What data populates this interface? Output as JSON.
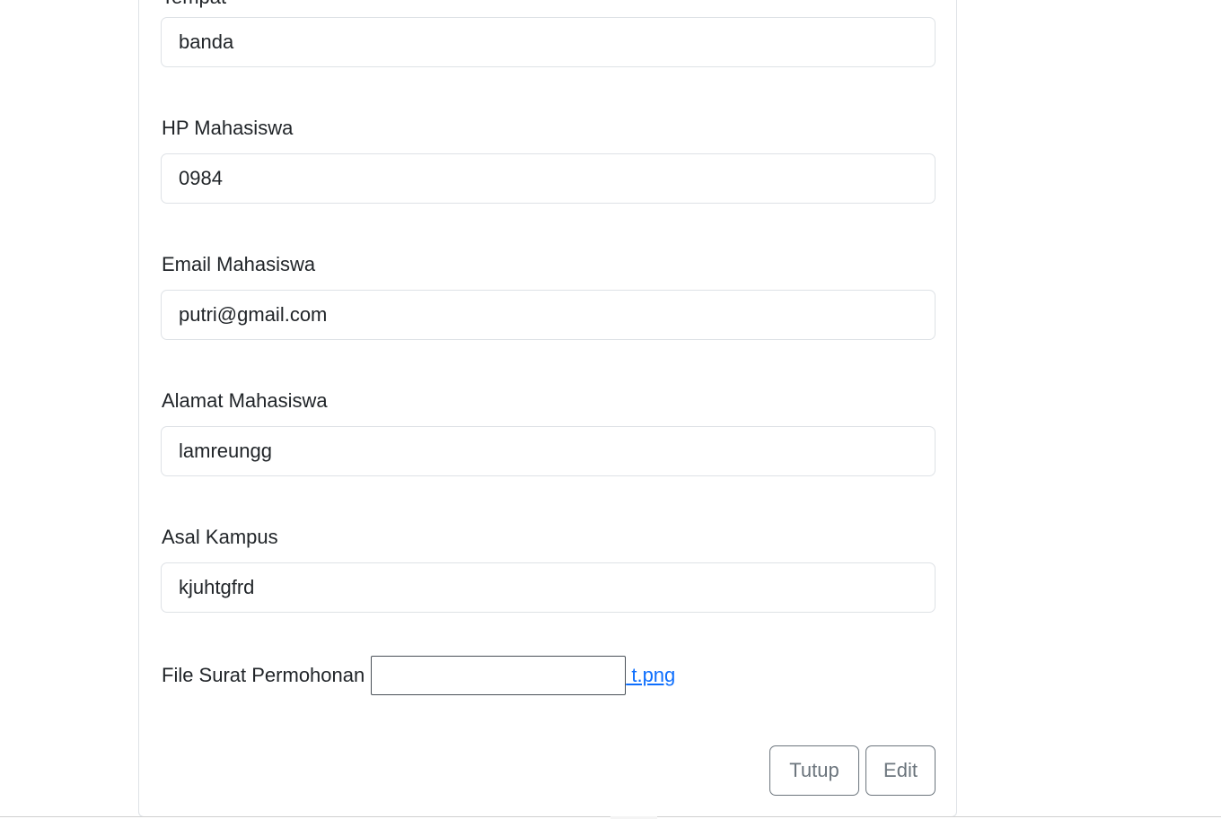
{
  "form": {
    "partial_label": "Tempat",
    "fields": [
      {
        "label": "",
        "value": "banda"
      },
      {
        "label": "HP Mahasiswa",
        "value": "0984"
      },
      {
        "label": "Email Mahasiswa",
        "value": "putri@gmail.com"
      },
      {
        "label": "Alamat Mahasiswa",
        "value": "lamreungg"
      },
      {
        "label": "Asal Kampus",
        "value": "kjuhtgfrd"
      }
    ],
    "file": {
      "label": "File Surat Permohonan",
      "link_text": " t.png"
    }
  },
  "buttons": {
    "close_label": "Tutup",
    "edit_label": "Edit"
  },
  "colors": {
    "text": "#212529",
    "border": "#dee2e6",
    "link": "#0d6efd",
    "button": "#6c757d"
  }
}
